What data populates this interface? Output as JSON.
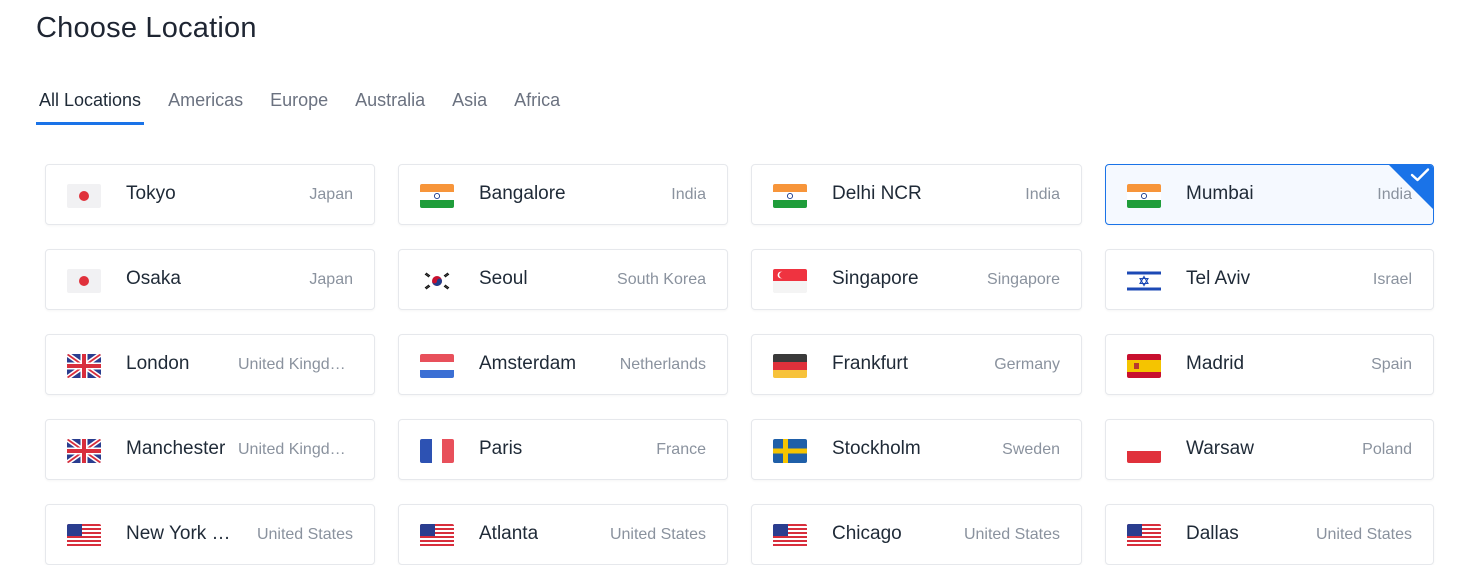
{
  "page": {
    "title": "Choose Location"
  },
  "tabs": [
    {
      "label": "All Locations",
      "active": true
    },
    {
      "label": "Americas"
    },
    {
      "label": "Europe"
    },
    {
      "label": "Australia"
    },
    {
      "label": "Asia"
    },
    {
      "label": "Africa"
    }
  ],
  "colors": {
    "accent": "#1a73e8",
    "selected_bg": "#f5f9ff"
  },
  "locations": [
    {
      "city": "Tokyo",
      "country": "Japan",
      "flag": "japan-flag-icon"
    },
    {
      "city": "Bangalore",
      "country": "India",
      "flag": "india-flag-icon"
    },
    {
      "city": "Delhi NCR",
      "country": "India",
      "flag": "india-flag-icon"
    },
    {
      "city": "Mumbai",
      "country": "India",
      "flag": "india-flag-icon",
      "selected": true,
      "selected_icon": "checkmark-icon"
    },
    {
      "city": "Osaka",
      "country": "Japan",
      "flag": "japan-flag-icon"
    },
    {
      "city": "Seoul",
      "country": "South Korea",
      "flag": "south-korea-flag-icon"
    },
    {
      "city": "Singapore",
      "country": "Singapore",
      "flag": "singapore-flag-icon"
    },
    {
      "city": "Tel Aviv",
      "country": "Israel",
      "flag": "israel-flag-icon"
    },
    {
      "city": "London",
      "country": "United Kingdo…",
      "flag": "uk-flag-icon"
    },
    {
      "city": "Amsterdam",
      "country": "Netherlands",
      "flag": "netherlands-flag-icon"
    },
    {
      "city": "Frankfurt",
      "country": "Germany",
      "flag": "germany-flag-icon"
    },
    {
      "city": "Madrid",
      "country": "Spain",
      "flag": "spain-flag-icon"
    },
    {
      "city": "Manchester",
      "country": "United Kingdo…",
      "flag": "uk-flag-icon"
    },
    {
      "city": "Paris",
      "country": "France",
      "flag": "france-flag-icon"
    },
    {
      "city": "Stockholm",
      "country": "Sweden",
      "flag": "sweden-flag-icon"
    },
    {
      "city": "Warsaw",
      "country": "Poland",
      "flag": "poland-flag-icon"
    },
    {
      "city": "New York (…",
      "country": "United States",
      "flag": "usa-flag-icon"
    },
    {
      "city": "Atlanta",
      "country": "United States",
      "flag": "usa-flag-icon"
    },
    {
      "city": "Chicago",
      "country": "United States",
      "flag": "usa-flag-icon"
    },
    {
      "city": "Dallas",
      "country": "United States",
      "flag": "usa-flag-icon"
    }
  ]
}
